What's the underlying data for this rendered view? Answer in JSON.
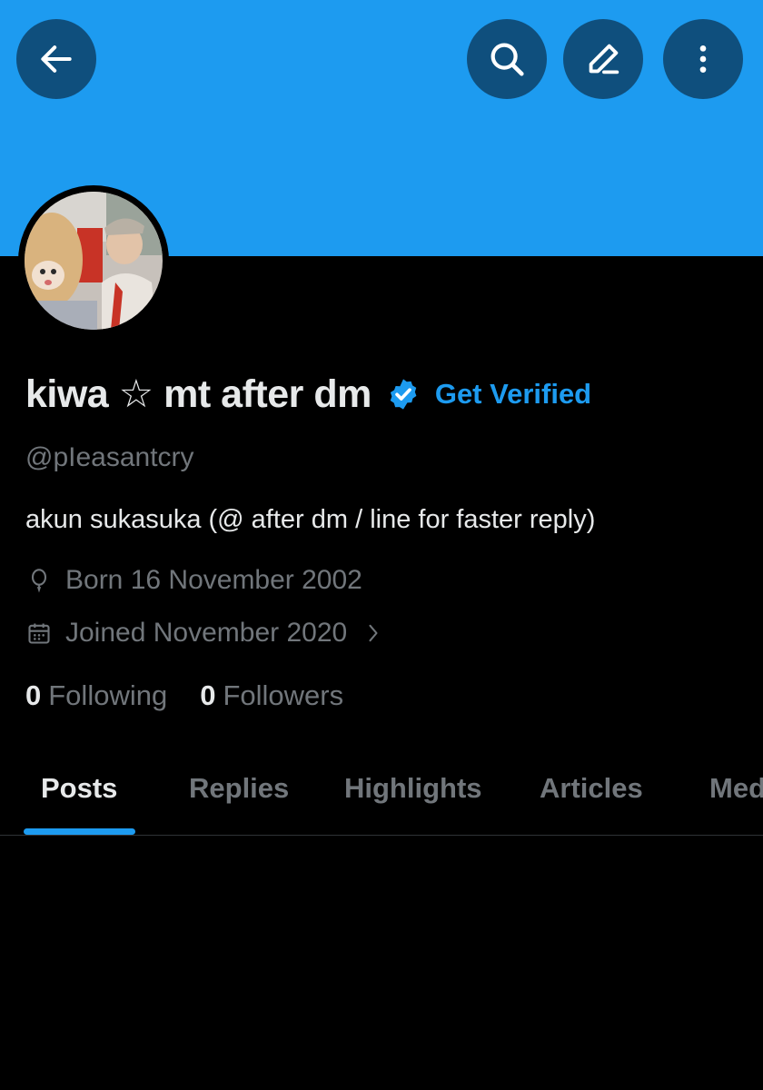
{
  "header": {
    "back_icon": "arrow-left-icon",
    "search_icon": "search-icon",
    "edit_icon": "pencil-icon",
    "more_icon": "more-vertical-icon",
    "banner_color": "#1d9bf0",
    "button_color": "#0f4f7d"
  },
  "profile": {
    "display_name": "kiwa ☆ mt after dm",
    "verified_icon": "verified-badge-icon",
    "get_verified_label": "Get Verified",
    "handle": "@pIeasantcry",
    "bio": "akun sukasuka (@ after dm / line for faster reply)",
    "born_icon": "balloon-icon",
    "born": "Born 16 November 2002",
    "joined_icon": "calendar-icon",
    "joined": "Joined November 2020",
    "accent_color": "#1d9bf0"
  },
  "stats": {
    "following_count": "0",
    "following_label": "Following",
    "followers_count": "0",
    "followers_label": "Followers"
  },
  "tabs": [
    {
      "label": "Posts",
      "active": true
    },
    {
      "label": "Replies",
      "active": false
    },
    {
      "label": "Highlights",
      "active": false
    },
    {
      "label": "Articles",
      "active": false
    },
    {
      "label": "Med",
      "active": false
    }
  ]
}
